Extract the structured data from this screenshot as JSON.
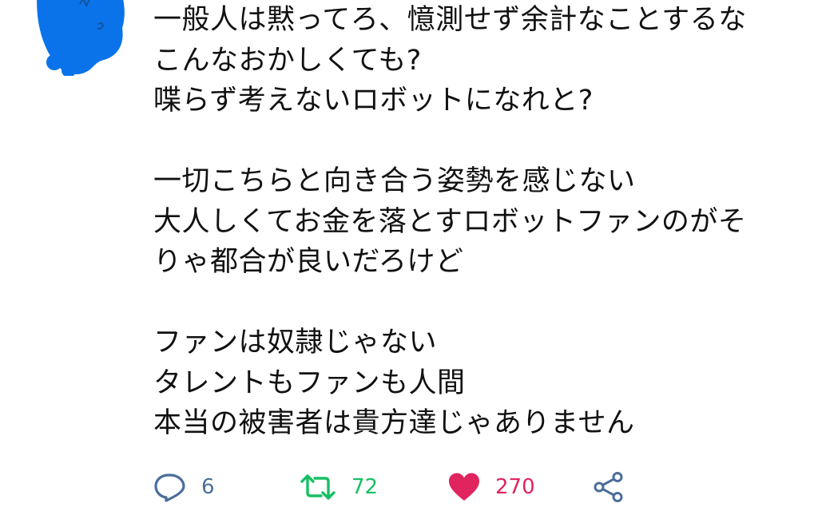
{
  "tweet": {
    "lines": [
      "一般人は黙ってろ、憶測せず余計なことするな",
      "こんなおかしくても?",
      "喋らず考えないロボットになれと?",
      "",
      "一切こちらと向き合う姿勢を感じない",
      "大人しくてお金を落とすロボットファンのがそ",
      "りゃ都合が良いだろけど",
      "",
      "ファンは奴隷じゃない",
      "タレントもファンも人間",
      "本当の被害者は貴方達じゃありません"
    ]
  },
  "actions": {
    "reply": {
      "icon": "reply-icon",
      "count": "6",
      "color": "#4a6e9a"
    },
    "retweet": {
      "icon": "retweet-icon",
      "count": "72",
      "color": "#17bf63"
    },
    "like": {
      "icon": "heart-icon",
      "count": "270",
      "color": "#e0245e",
      "liked": true
    },
    "share": {
      "icon": "share-icon",
      "color": "#4a6e9a"
    }
  },
  "colors": {
    "text": "#111111",
    "background": "#ffffff",
    "avatar_blur": "#0a73ea"
  }
}
